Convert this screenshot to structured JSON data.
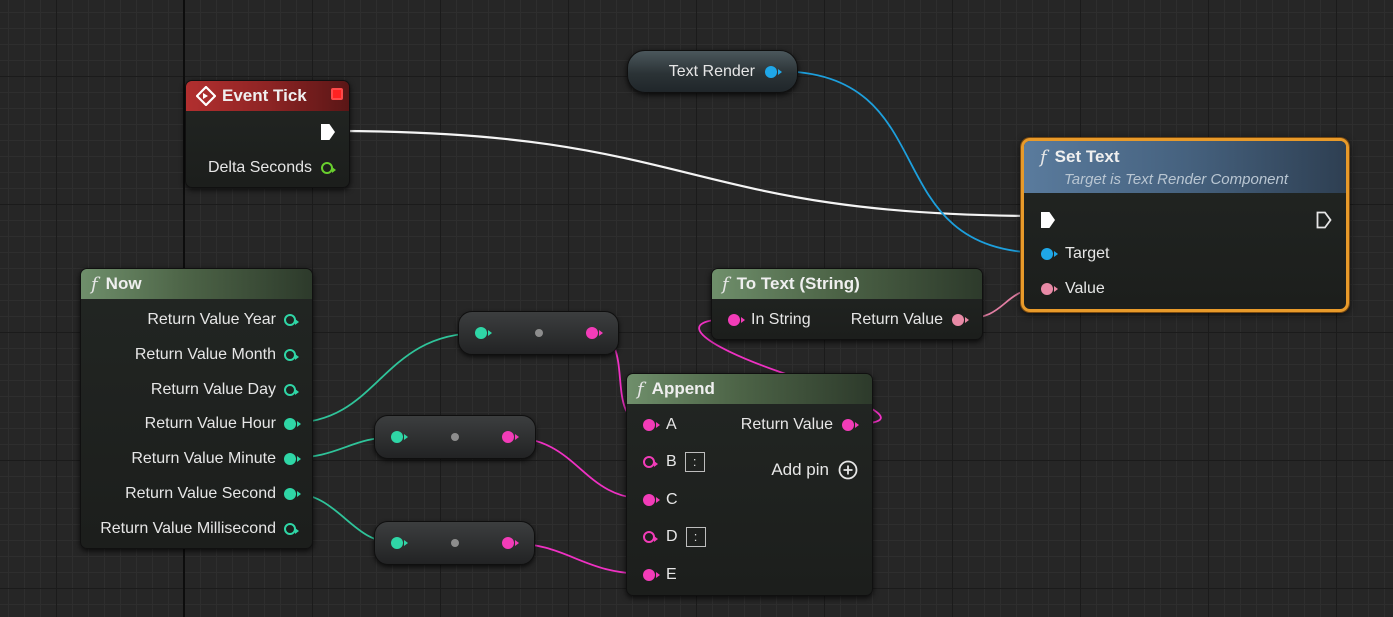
{
  "colors": {
    "exec": "#ffffff",
    "object": "#1fa7e8",
    "string": "#f23cb8",
    "text": "#e88aa6",
    "int": "#2fd6a6",
    "float": "#69cf2e",
    "event_header": "#a72a2a",
    "function_header": "#5a7a55",
    "settext_header": "#4f6d8d",
    "selected_outline": "#e89a2a"
  },
  "nodes": {
    "event_tick": {
      "title": "Event Tick",
      "icon": "event-diamond-icon",
      "delta_label": "Delta Seconds"
    },
    "text_render": {
      "label": "Text Render"
    },
    "set_text": {
      "title": "Set Text",
      "subtitle": "Target is Text Render Component",
      "target_label": "Target",
      "value_label": "Value"
    },
    "now": {
      "title": "Now",
      "outputs": [
        "Return Value Year",
        "Return Value Month",
        "Return Value Day",
        "Return Value Hour",
        "Return Value Minute",
        "Return Value Second",
        "Return Value Millisecond"
      ]
    },
    "to_text": {
      "title": "To Text (String)",
      "in_label": "In String",
      "out_label": "Return Value"
    },
    "append": {
      "title": "Append",
      "a_label": "A",
      "b_label": "B",
      "b_literal": ":",
      "c_label": "C",
      "d_label": "D",
      "d_literal": ":",
      "e_label": "E",
      "out_label": "Return Value",
      "add_pin_label": "Add pin"
    }
  }
}
